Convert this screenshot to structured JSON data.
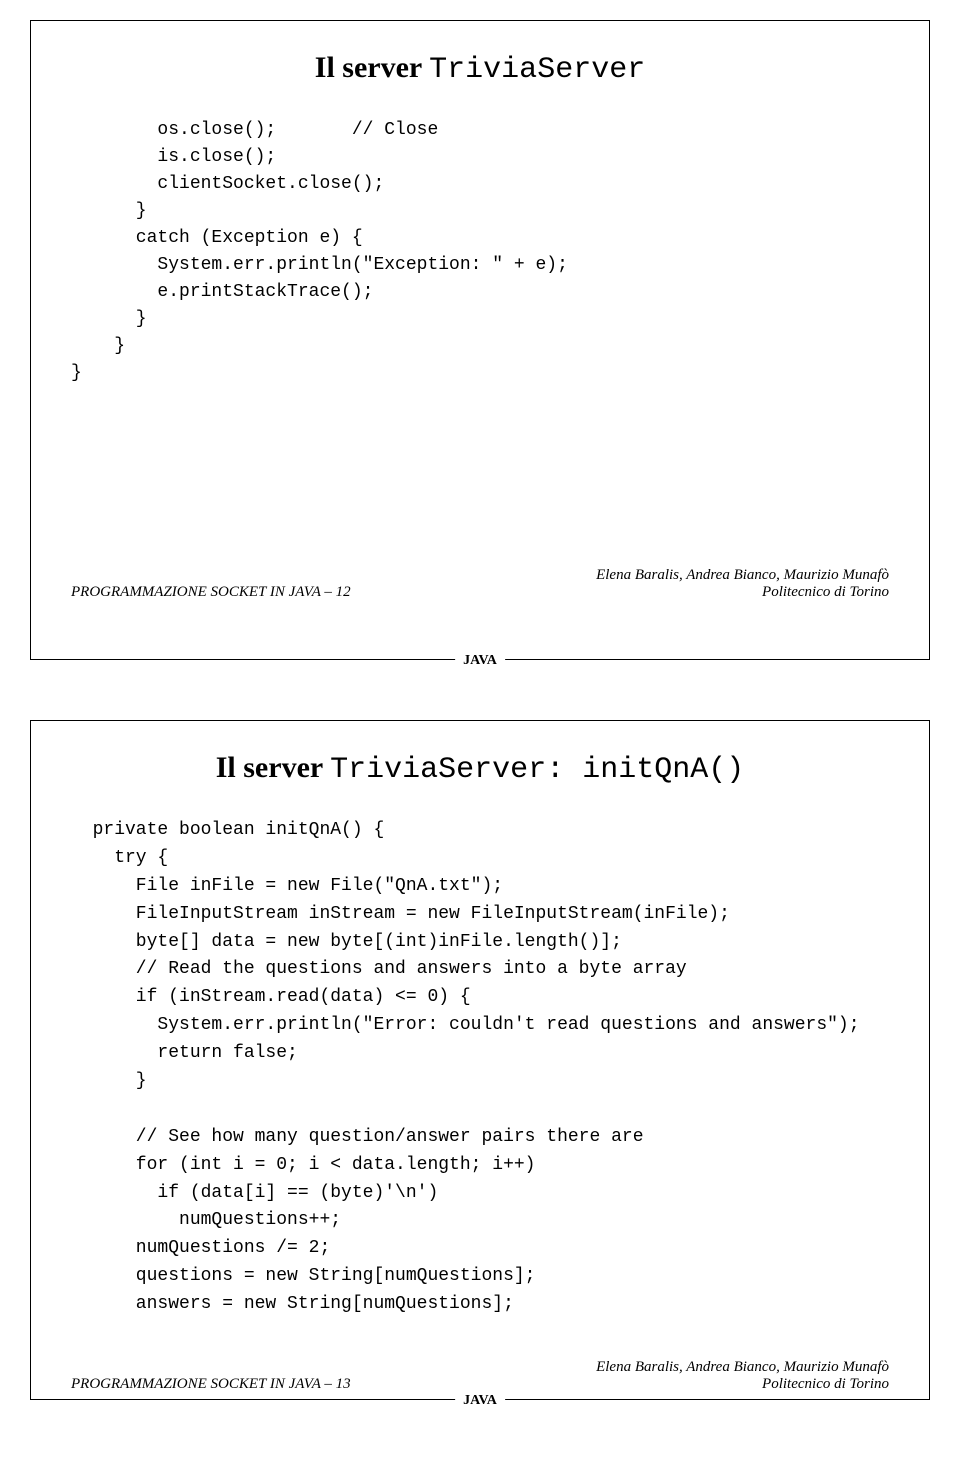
{
  "slide1": {
    "title_bold": "Il server ",
    "title_mono": "TriviaServer",
    "code": "        os.close();       // Close\n        is.close();\n        clientSocket.close();\n      }\n      catch (Exception e) {\n        System.err.println(\"Exception: \" + e);\n        e.printStackTrace();\n      }\n    }\n}",
    "footer_left": "PROGRAMMAZIONE SOCKET IN JAVA – 12",
    "footer_right_1": "Elena Baralis, Andrea Bianco, Maurizio Munafò",
    "footer_right_2": "Politecnico di Torino",
    "tab": "JAVA"
  },
  "slide2": {
    "title_bold": "Il server ",
    "title_mono": "TriviaServer:  initQnA()",
    "code": "  private boolean initQnA() {\n    try {\n      File inFile = new File(\"QnA.txt\");\n      FileInputStream inStream = new FileInputStream(inFile);\n      byte[] data = new byte[(int)inFile.length()];\n      // Read the questions and answers into a byte array\n      if (inStream.read(data) <= 0) {\n        System.err.println(\"Error: couldn't read questions and answers\");\n        return false;\n      }\n\n      // See how many question/answer pairs there are\n      for (int i = 0; i < data.length; i++)\n        if (data[i] == (byte)'\\n')\n          numQuestions++;\n      numQuestions /= 2;\n      questions = new String[numQuestions];\n      answers = new String[numQuestions];",
    "footer_left": "PROGRAMMAZIONE SOCKET IN JAVA – 13",
    "footer_right_1": "Elena Baralis, Andrea Bianco, Maurizio Munafò",
    "footer_right_2": "Politecnico di Torino",
    "tab": "JAVA"
  }
}
